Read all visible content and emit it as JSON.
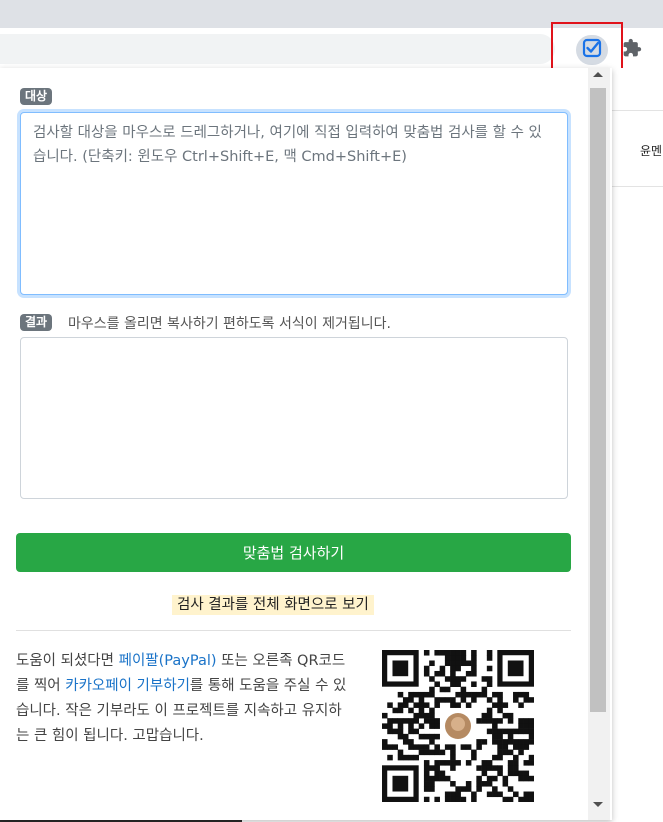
{
  "browser": {
    "background_page_text": "윤멘",
    "extension_icon": "checkbox-icon",
    "puzzle_icon": "puzzle-icon"
  },
  "popup": {
    "target_badge": "대상",
    "input_placeholder": "검사할 대상을 마우스로 드레그하거나, 여기에 직접 입력하여 맞춤법 검사를 할 수 있습니다. (단축키: 윈도우 Ctrl+Shift+E, 맥 Cmd+Shift+E)",
    "result_badge": "결과",
    "result_hint": "마우스를 올리면 복사하기 편하도록 서식이 제거됩니다.",
    "check_button": "맞춤법 검사하기",
    "fullscreen_link": "검사 결과를 전체 화면으로 보기",
    "donate": {
      "t1": "도움이 되셨다면 ",
      "paypal": "페이팔(PayPal)",
      "t2": " 또는 오른족 QR코드를 찍어 ",
      "kakao": "카카오페이 기부하기",
      "t3": "를 통해 도움을 주실 수 있습니다. 작은 기부라도 이 프로젝트를 지속하고 유지하는 큰 힘이 됩니다. 고맙습니다."
    }
  },
  "colors": {
    "accent_green": "#28a745",
    "link_blue": "#1a73c8",
    "highlight_red": "#e0131b",
    "focus_blue": "#80bdff"
  }
}
